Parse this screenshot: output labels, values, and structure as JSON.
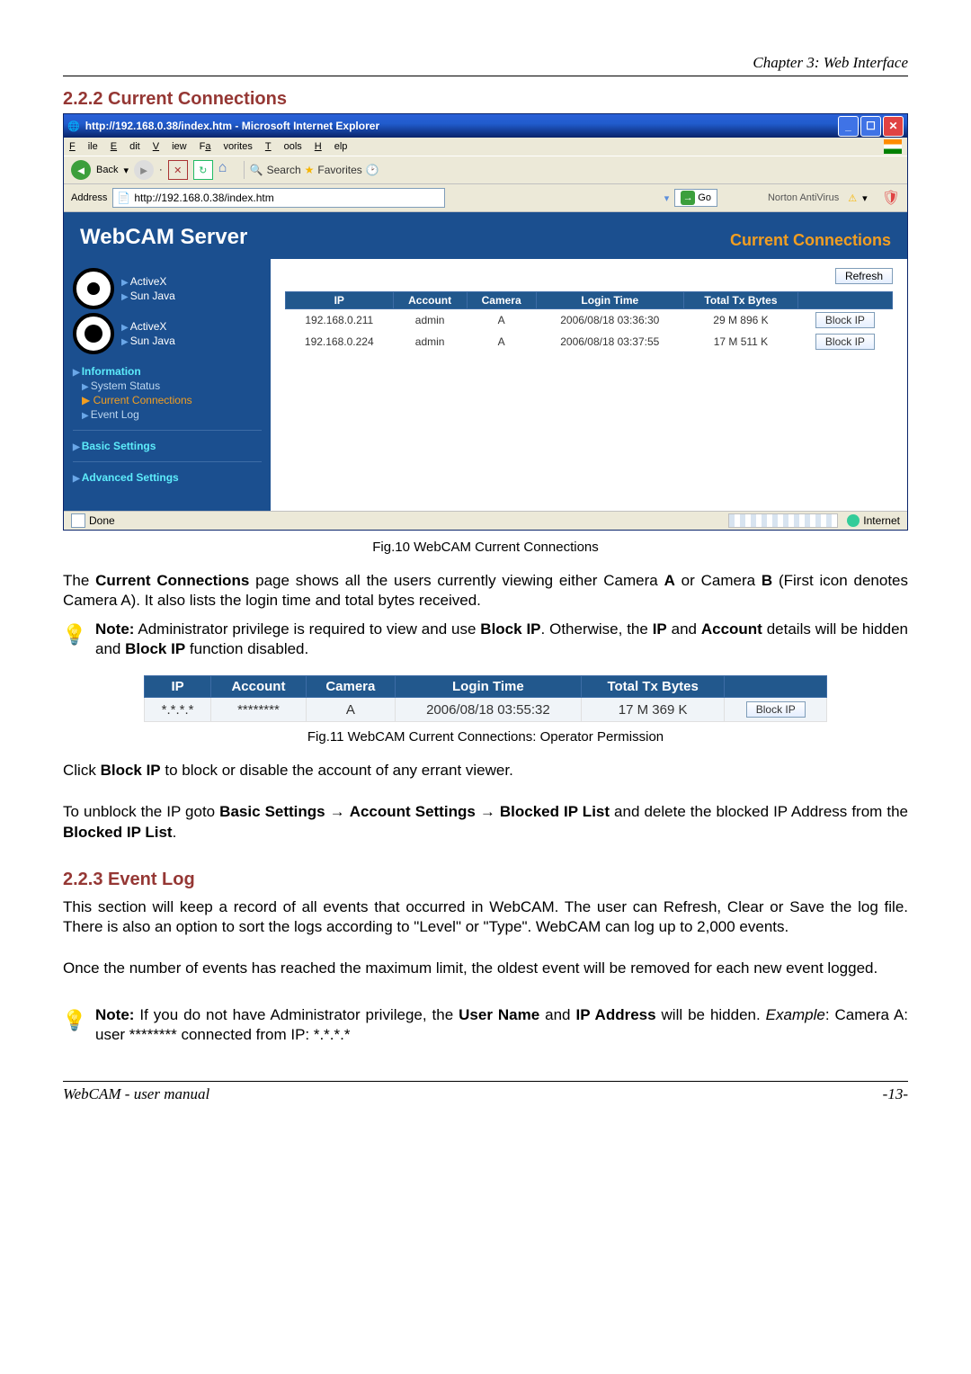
{
  "chapter": "Chapter 3: Web Interface",
  "section1": "2.2.2 Current Connections",
  "browser": {
    "title": "http://192.168.0.38/index.htm - Microsoft Internet Explorer",
    "menu": {
      "file": "File",
      "edit": "Edit",
      "view": "View",
      "fav": "Favorites",
      "tools": "Tools",
      "help": "Help"
    },
    "toolbar": {
      "back": "Back",
      "search": "Search",
      "favorites": "Favorites"
    },
    "addr_label": "Address",
    "addr_value": "http://192.168.0.38/index.htm",
    "go": "Go",
    "nav": "Norton AntiVirus",
    "status_left": "Done",
    "status_right": "Internet"
  },
  "webcam": {
    "title": "WebCAM Server",
    "cc_title": "Current Connections",
    "sidebar": {
      "activex": "ActiveX",
      "sunjava": "Sun Java",
      "info": "Information",
      "sys": "System Status",
      "cc": "Current Connections",
      "ev": "Event Log",
      "basic": "Basic Settings",
      "adv": "Advanced Settings"
    },
    "refresh": "Refresh",
    "th": {
      "ip": "IP",
      "acct": "Account",
      "cam": "Camera",
      "login": "Login Time",
      "tx": "Total Tx Bytes"
    },
    "rows": [
      {
        "ip": "192.168.0.211",
        "acct": "admin",
        "cam": "A",
        "login": "2006/08/18 03:36:30",
        "tx": "29 M 896 K",
        "btn": "Block IP"
      },
      {
        "ip": "192.168.0.224",
        "acct": "admin",
        "cam": "A",
        "login": "2006/08/18 03:37:55",
        "tx": "17 M 511 K",
        "btn": "Block IP"
      }
    ]
  },
  "fig10": "Fig.10  WebCAM Current Connections",
  "para1a": "The ",
  "para1b": "Current Connections",
  "para1c": " page shows all the users currently viewing either Camera ",
  "para1d": "A",
  "para1e": " or Camera ",
  "para1f": "B",
  "para1g": " (First icon denotes Camera A).   It also lists the login time and total bytes received.",
  "note1a": "Note:",
  "note1b": "   Administrator privilege is required to view and use ",
  "note1c": "Block IP",
  "note1d": ".   Otherwise, the ",
  "note1e": "IP",
  "note1f": " and ",
  "note1g": "Account",
  "note1h": " details will be hidden and ",
  "note1i": "Block IP",
  "note1j": " function disabled.",
  "perm": {
    "th": {
      "ip": "IP",
      "acct": "Account",
      "cam": "Camera",
      "login": "Login Time",
      "tx": "Total Tx Bytes",
      "btn": ""
    },
    "row": {
      "ip": "*.*.*.*",
      "acct": "********",
      "cam": "A",
      "login": "2006/08/18 03:55:32",
      "tx": "17 M 369 K",
      "btn": "Block IP"
    }
  },
  "fig11": "Fig.11  WebCAM Current Connections: Operator Permission",
  "para2a": "Click ",
  "para2b": "Block IP",
  "para2c": " to block or disable the account of any errant viewer.",
  "para3a": "To unblock the IP goto ",
  "para3b": "Basic Settings",
  "para3c": " → ",
  "para3d": "Account Settings",
  "para3e": " → ",
  "para3f": "Blocked IP List",
  "para3g": " and delete the blocked IP Address from the ",
  "para3h": "Blocked IP List",
  "para3i": ".",
  "section2": "2.2.3 Event Log",
  "para4": "This section will keep a record of all events that occurred in WebCAM.   The user can Refresh, Clear or Save the log file.   There is also an option to sort the logs according to \"Level\" or \"Type\".   WebCAM can log up to 2,000 events.",
  "para5": "Once the number of events has reached the maximum limit, the oldest event will be removed for each new event logged.",
  "note2a": "Note:",
  "note2b": "   If you do not have Administrator privilege, the ",
  "note2c": "User Name",
  "note2d": " and ",
  "note2e": "IP Address",
  "note2f": " will be hidden.   ",
  "note2g": "Example",
  "note2h": ": Camera A: user ******** connected from IP: *.*.*.*",
  "footer_left": "WebCAM - user manual",
  "footer_right": "-13-"
}
